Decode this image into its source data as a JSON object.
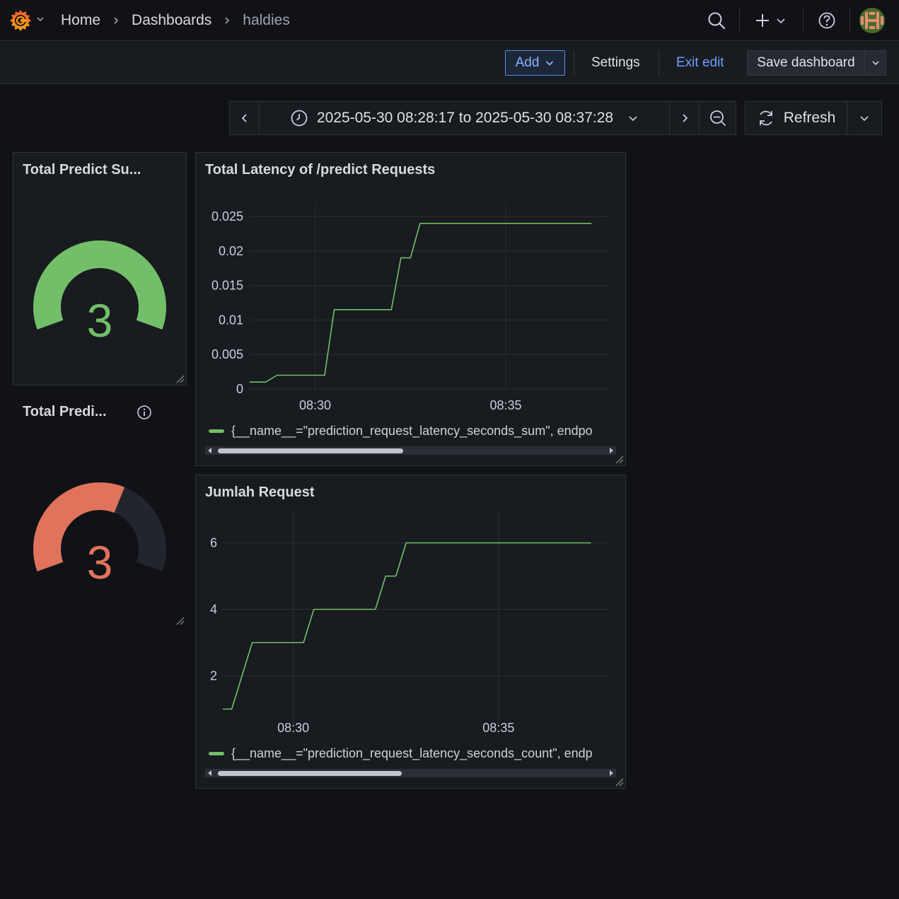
{
  "breadcrumbs": [
    "Home",
    "Dashboards",
    "haldies"
  ],
  "toolbar": {
    "add_label": "Add",
    "settings_label": "Settings",
    "exit_label": "Exit edit",
    "save_label": "Save dashboard"
  },
  "time": {
    "range": "2025-05-30 08:28:17 to 2025-05-30 08:37:28",
    "refresh_label": "Refresh"
  },
  "colors": {
    "green": "#73bf69",
    "red": "#e0735b",
    "accent": "#6e9fff"
  },
  "panels": {
    "success_gauge": {
      "title": "Total Predict Su...",
      "value": "3",
      "fill": 1.0,
      "color": "#73bf69"
    },
    "total_gauge": {
      "title": "Total Predi...",
      "value": "3",
      "fill": 0.6,
      "color": "#e0735b"
    },
    "latency": {
      "title": "Total Latency of /predict Requests",
      "legend": "{__name__=\"prediction_request_latency_seconds_sum\", endpo"
    },
    "requests": {
      "title": "Jumlah Request",
      "legend": "{__name__=\"prediction_request_latency_seconds_count\", endp"
    }
  },
  "chart_data": [
    {
      "type": "line",
      "title": "Total Latency of /predict Requests",
      "x_ticks": [
        "08:30",
        "08:35"
      ],
      "y_ticks": [
        "0",
        "0.005",
        "0.01",
        "0.015",
        "0.02",
        "0.025"
      ],
      "ylim": [
        0,
        0.025
      ],
      "xlim": [
        "08:28:17",
        "08:37:28"
      ],
      "series": [
        {
          "color": "#73bf69",
          "x": [
            "08:28:17",
            "08:28:42",
            "08:29:00",
            "08:30:15",
            "08:30:30",
            "08:32:00",
            "08:32:15",
            "08:32:30",
            "08:32:45",
            "08:37:15"
          ],
          "y": [
            0.001,
            0.001,
            0.002,
            0.002,
            0.0115,
            0.0115,
            0.019,
            0.019,
            0.024,
            0.024
          ]
        }
      ],
      "grid": true
    },
    {
      "type": "line",
      "title": "Jumlah Request",
      "x_ticks": [
        "08:30",
        "08:35"
      ],
      "y_ticks": [
        "2",
        "4",
        "6"
      ],
      "ylim": [
        0.5,
        6.5
      ],
      "xlim": [
        "08:28:17",
        "08:37:28"
      ],
      "series": [
        {
          "color": "#73bf69",
          "x": [
            "08:28:17",
            "08:28:30",
            "08:29:00",
            "08:30:15",
            "08:30:30",
            "08:32:00",
            "08:32:15",
            "08:32:30",
            "08:32:45",
            "08:37:15"
          ],
          "y": [
            1,
            1,
            3,
            3,
            4,
            4,
            5,
            5,
            6,
            6
          ]
        }
      ],
      "grid": true
    }
  ]
}
